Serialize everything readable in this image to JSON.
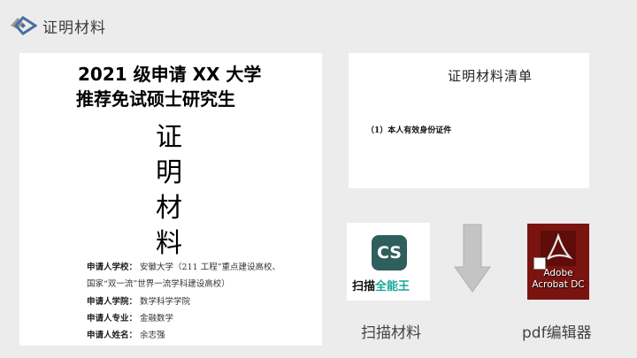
{
  "header": {
    "title": "证明材料"
  },
  "doc_cover": {
    "title_line1": "2021 级申请 XX 大学",
    "title_line2": "推荐免试硕士研究生",
    "big_chars": [
      "证",
      "明",
      "材",
      "料"
    ],
    "info": {
      "school_label": "申请人学校：",
      "school_value": "安徽大学（211 工程”重点建设高校、",
      "school_value2": "国家“双一流”世界一流学科建设高校）",
      "college_label": "申请人学院：",
      "college_value": "数学科学学院",
      "major_label": "申请人专业：",
      "major_value": "金融数学",
      "name_label": "申请人姓名：",
      "name_value": "余志强"
    }
  },
  "checklist": {
    "title": "证明材料清单",
    "item1": "（1）本人有效身份证件"
  },
  "apps": {
    "scanner": {
      "icon_text": "CS",
      "name_part1": "扫描",
      "name_part2": "全能王",
      "caption": "扫描材料"
    },
    "pdf_editor": {
      "caption_line1": "Adobe",
      "caption_line2": "Acrobat DC",
      "caption": "pdf编辑器"
    }
  },
  "colors": {
    "background": "#ececec",
    "cs_brand": "#2f5f5c",
    "cs_text": "#19a89b",
    "acrobat_bg": "#7a1410"
  }
}
